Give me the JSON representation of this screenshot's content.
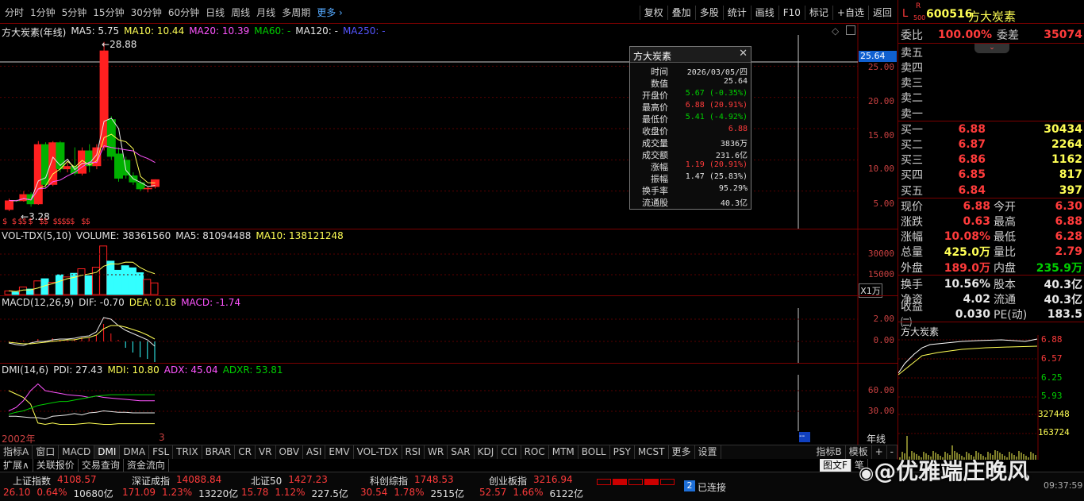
{
  "toolbar": {
    "periods": [
      "分时",
      "1分钟",
      "5分钟",
      "15分钟",
      "30分钟",
      "60分钟",
      "日线",
      "周线",
      "月线",
      "多周期"
    ],
    "more": "更多",
    "tools": [
      "复权",
      "叠加",
      "多股",
      "统计",
      "画线",
      "F10",
      "标记",
      "+自选",
      "返回"
    ]
  },
  "chart": {
    "stock_title": "方大炭素(年线)",
    "ma": [
      {
        "label": "MA5: 5.75",
        "color": "#e8e8e8"
      },
      {
        "label": "MA10: 10.44",
        "color": "#ffff55"
      },
      {
        "label": "MA20: 10.39",
        "color": "#ff55ff"
      },
      {
        "label": "MA60: -",
        "color": "#00d000"
      },
      {
        "label": "MA120: -",
        "color": "#e8e8e8"
      },
      {
        "label": "MA250: -",
        "color": "#5555ff"
      }
    ],
    "price_axis": [
      "25.00",
      "20.00",
      "15.00",
      "10.00",
      "5.00"
    ],
    "current_price_tag": "25.64",
    "high_label": "28.88",
    "low_label": "3.28",
    "vol_legend": {
      "name": "VOL-TDX(5,10)",
      "volume": "VOLUME: 38361560",
      "ma5": "MA5: 81094488",
      "ma10": "MA10: 138121248"
    },
    "vol_axis": [
      "30000",
      "15000"
    ],
    "vol_unit": "X1万",
    "macd_legend": {
      "name": "MACD(12,26,9)",
      "dif": "DIF: -0.70",
      "dea": "DEA: 0.18",
      "macd": "MACD: -1.74"
    },
    "macd_axis": [
      "2.00",
      "0.00"
    ],
    "dmi_legend": {
      "name": "DMI(14,6)",
      "pdi": "PDI: 27.43",
      "mdi": "MDI: 10.80",
      "adx": "ADX: 45.04",
      "adxr": "ADXR: 53.81"
    },
    "dmi_axis": [
      "60.00",
      "30.00"
    ],
    "x_start": "2002年",
    "x_mid": "3",
    "x_period": "年线"
  },
  "tooltip": {
    "title": "方大炭素",
    "rows": [
      {
        "k": "时间",
        "v": "2026/03/05/四",
        "c": "#e0e0e0"
      },
      {
        "k": "数值",
        "v": "25.64",
        "c": "#e0e0e0"
      },
      {
        "k": "开盘价",
        "v": "5.67 (-0.35%)",
        "c": "#00d000"
      },
      {
        "k": "最高价",
        "v": "6.88 (20.91%)",
        "c": "#ff3b3b"
      },
      {
        "k": "最低价",
        "v": "5.41 (-4.92%)",
        "c": "#00d000"
      },
      {
        "k": "收盘价",
        "v": "6.88",
        "c": "#ff3b3b"
      },
      {
        "k": "成交量",
        "v": "3836万",
        "c": "#e0e0e0"
      },
      {
        "k": "成交额",
        "v": "231.6亿",
        "c": "#e0e0e0"
      },
      {
        "k": "涨幅",
        "v": "1.19 (20.91%)",
        "c": "#ff3b3b"
      },
      {
        "k": "振幅",
        "v": "1.47 (25.83%)",
        "c": "#e0e0e0"
      },
      {
        "k": "换手率",
        "v": "95.29%",
        "c": "#e0e0e0"
      },
      {
        "k": "流通股",
        "v": "40.3亿",
        "c": "#e0e0e0"
      }
    ]
  },
  "quote": {
    "flag_l": "L",
    "flag_r": "R",
    "flag_500": "500",
    "code": "600516",
    "name": "方大炭素",
    "weibi_label": "委比",
    "weibi": "100.00%",
    "weicha_label": "委差",
    "weicha": "35074",
    "sells": [
      {
        "l": "卖五"
      },
      {
        "l": "卖四"
      },
      {
        "l": "卖三"
      },
      {
        "l": "卖二"
      },
      {
        "l": "卖一"
      }
    ],
    "buys": [
      {
        "l": "买一",
        "p": "6.88",
        "v": "30434"
      },
      {
        "l": "买二",
        "p": "6.87",
        "v": "2264"
      },
      {
        "l": "买三",
        "p": "6.86",
        "v": "1162"
      },
      {
        "l": "买四",
        "p": "6.85",
        "v": "817"
      },
      {
        "l": "买五",
        "p": "6.84",
        "v": "397"
      }
    ],
    "stats": [
      {
        "l1": "现价",
        "v1": "6.88",
        "c1": "#ff3b3b",
        "l2": "今开",
        "v2": "6.30",
        "c2": "#ff3b3b"
      },
      {
        "l1": "涨跌",
        "v1": "0.63",
        "c1": "#ff3b3b",
        "l2": "最高",
        "v2": "6.88",
        "c2": "#ff3b3b"
      },
      {
        "l1": "涨幅",
        "v1": "10.08%",
        "c1": "#ff3b3b",
        "l2": "最低",
        "v2": "6.28",
        "c2": "#ff3b3b"
      },
      {
        "l1": "总量",
        "v1": "425.0万",
        "c1": "#ffff55",
        "l2": "量比",
        "v2": "2.79",
        "c2": "#ff3b3b"
      },
      {
        "l1": "外盘",
        "v1": "189.0万",
        "c1": "#ff3b3b",
        "l2": "内盘",
        "v2": "235.9万",
        "c2": "#00d000"
      },
      {
        "l1": "换手",
        "v1": "10.56%",
        "c1": "#e8e8e8",
        "l2": "股本",
        "v2": "40.3亿",
        "c2": "#e8e8e8"
      },
      {
        "l1": "净资",
        "v1": "4.02",
        "c1": "#e8e8e8",
        "l2": "流通",
        "v2": "40.3亿",
        "c2": "#e8e8e8"
      },
      {
        "l1": "收益㈢",
        "v1": "0.030",
        "c1": "#e8e8e8",
        "l2": "PE(动)",
        "v2": "183.5",
        "c2": "#e8e8e8"
      }
    ],
    "mini_title": "方大炭素",
    "mini_axis": [
      "6.88",
      "6.57",
      "6.25",
      "5.93",
      "327448",
      "163724"
    ]
  },
  "indicators": [
    "指标A",
    "窗口",
    "MACD",
    "DMI",
    "DMA",
    "FSL",
    "TRIX",
    "BRAR",
    "CR",
    "VR",
    "OBV",
    "ASI",
    "EMV",
    "VOL-TDX",
    "RSI",
    "WR",
    "SAR",
    "KDJ",
    "CCI",
    "ROC",
    "MTM",
    "BOLL",
    "PSY",
    "MCST",
    "更多",
    "设置"
  ],
  "indicator_right": [
    "指标B",
    "模板",
    "+",
    "-"
  ],
  "bottom_tabs": [
    "扩展∧",
    "关联报价",
    "交易查询",
    "资金流向"
  ],
  "mini_tabs": [
    "图文F",
    "笔"
  ],
  "status": {
    "indices": [
      {
        "name": "上证指数",
        "value": "4108.57",
        "chg": "26.10",
        "pct": "0.64%",
        "amt": "10680亿"
      },
      {
        "name": "深证成指",
        "value": "14088.84",
        "chg": "171.09",
        "pct": "1.23%",
        "amt": "13220亿"
      },
      {
        "name": "北证50",
        "value": "1427.23",
        "chg": "15.78",
        "pct": "1.12%",
        "amt": "227.5亿"
      },
      {
        "name": "科创综指",
        "value": "1748.53",
        "chg": "30.54",
        "pct": "1.78%",
        "amt": "2515亿"
      },
      {
        "name": "创业板指",
        "value": "3216.94",
        "chg": "52.57",
        "pct": "1.66%",
        "amt": "6122亿"
      }
    ],
    "conn_num": "2",
    "conn_text": "已连接",
    "watermark": "@优雅端庄晚风",
    "time": "09:37:59"
  },
  "chart_data": {
    "type": "candlestick",
    "title": "方大炭素(年线)",
    "candles": [
      {
        "o": 2.0,
        "h": 3.8,
        "l": 1.8,
        "c": 3.5
      },
      {
        "o": 3.5,
        "h": 3.6,
        "l": 3.28,
        "c": 3.4
      },
      {
        "o": 3.4,
        "h": 5.0,
        "l": 3.3,
        "c": 4.5
      },
      {
        "o": 4.5,
        "h": 4.8,
        "l": 2.5,
        "c": 2.9
      },
      {
        "o": 2.9,
        "h": 13.0,
        "l": 2.8,
        "c": 12.5
      },
      {
        "o": 12.5,
        "h": 12.8,
        "l": 5.5,
        "c": 6.0
      },
      {
        "o": 6.0,
        "h": 13.0,
        "l": 5.8,
        "c": 12.8
      },
      {
        "o": 12.8,
        "h": 13.0,
        "l": 8.0,
        "c": 8.5
      },
      {
        "o": 8.5,
        "h": 9.5,
        "l": 8.0,
        "c": 9.0
      },
      {
        "o": 9.0,
        "h": 12.0,
        "l": 7.5,
        "c": 7.8
      },
      {
        "o": 7.8,
        "h": 12.0,
        "l": 7.5,
        "c": 11.5
      },
      {
        "o": 11.5,
        "h": 12.5,
        "l": 8.0,
        "c": 9.0
      },
      {
        "o": 9.0,
        "h": 12.5,
        "l": 8.5,
        "c": 12.0
      },
      {
        "o": 12.0,
        "h": 28.88,
        "l": 11.5,
        "c": 27.5
      },
      {
        "o": 16.5,
        "h": 17.0,
        "l": 10.0,
        "c": 10.5
      },
      {
        "o": 11.0,
        "h": 12.0,
        "l": 6.5,
        "c": 7.0
      },
      {
        "o": 10.0,
        "h": 10.5,
        "l": 7.0,
        "c": 7.5
      },
      {
        "o": 7.5,
        "h": 8.0,
        "l": 6.0,
        "c": 6.4
      },
      {
        "o": 6.4,
        "h": 6.8,
        "l": 5.0,
        "c": 5.3
      },
      {
        "o": 5.3,
        "h": 5.8,
        "l": 4.8,
        "c": 5.5
      },
      {
        "o": 5.67,
        "h": 6.88,
        "l": 5.41,
        "c": 6.88
      }
    ],
    "volume": [
      1200,
      800,
      2500,
      1800,
      4500,
      5200,
      4000,
      6500,
      5800,
      7000,
      8500,
      6200,
      9000,
      16000,
      11000,
      8000,
      9500,
      8800,
      7200,
      5000,
      3836
    ],
    "ylim": [
      0,
      30
    ]
  }
}
